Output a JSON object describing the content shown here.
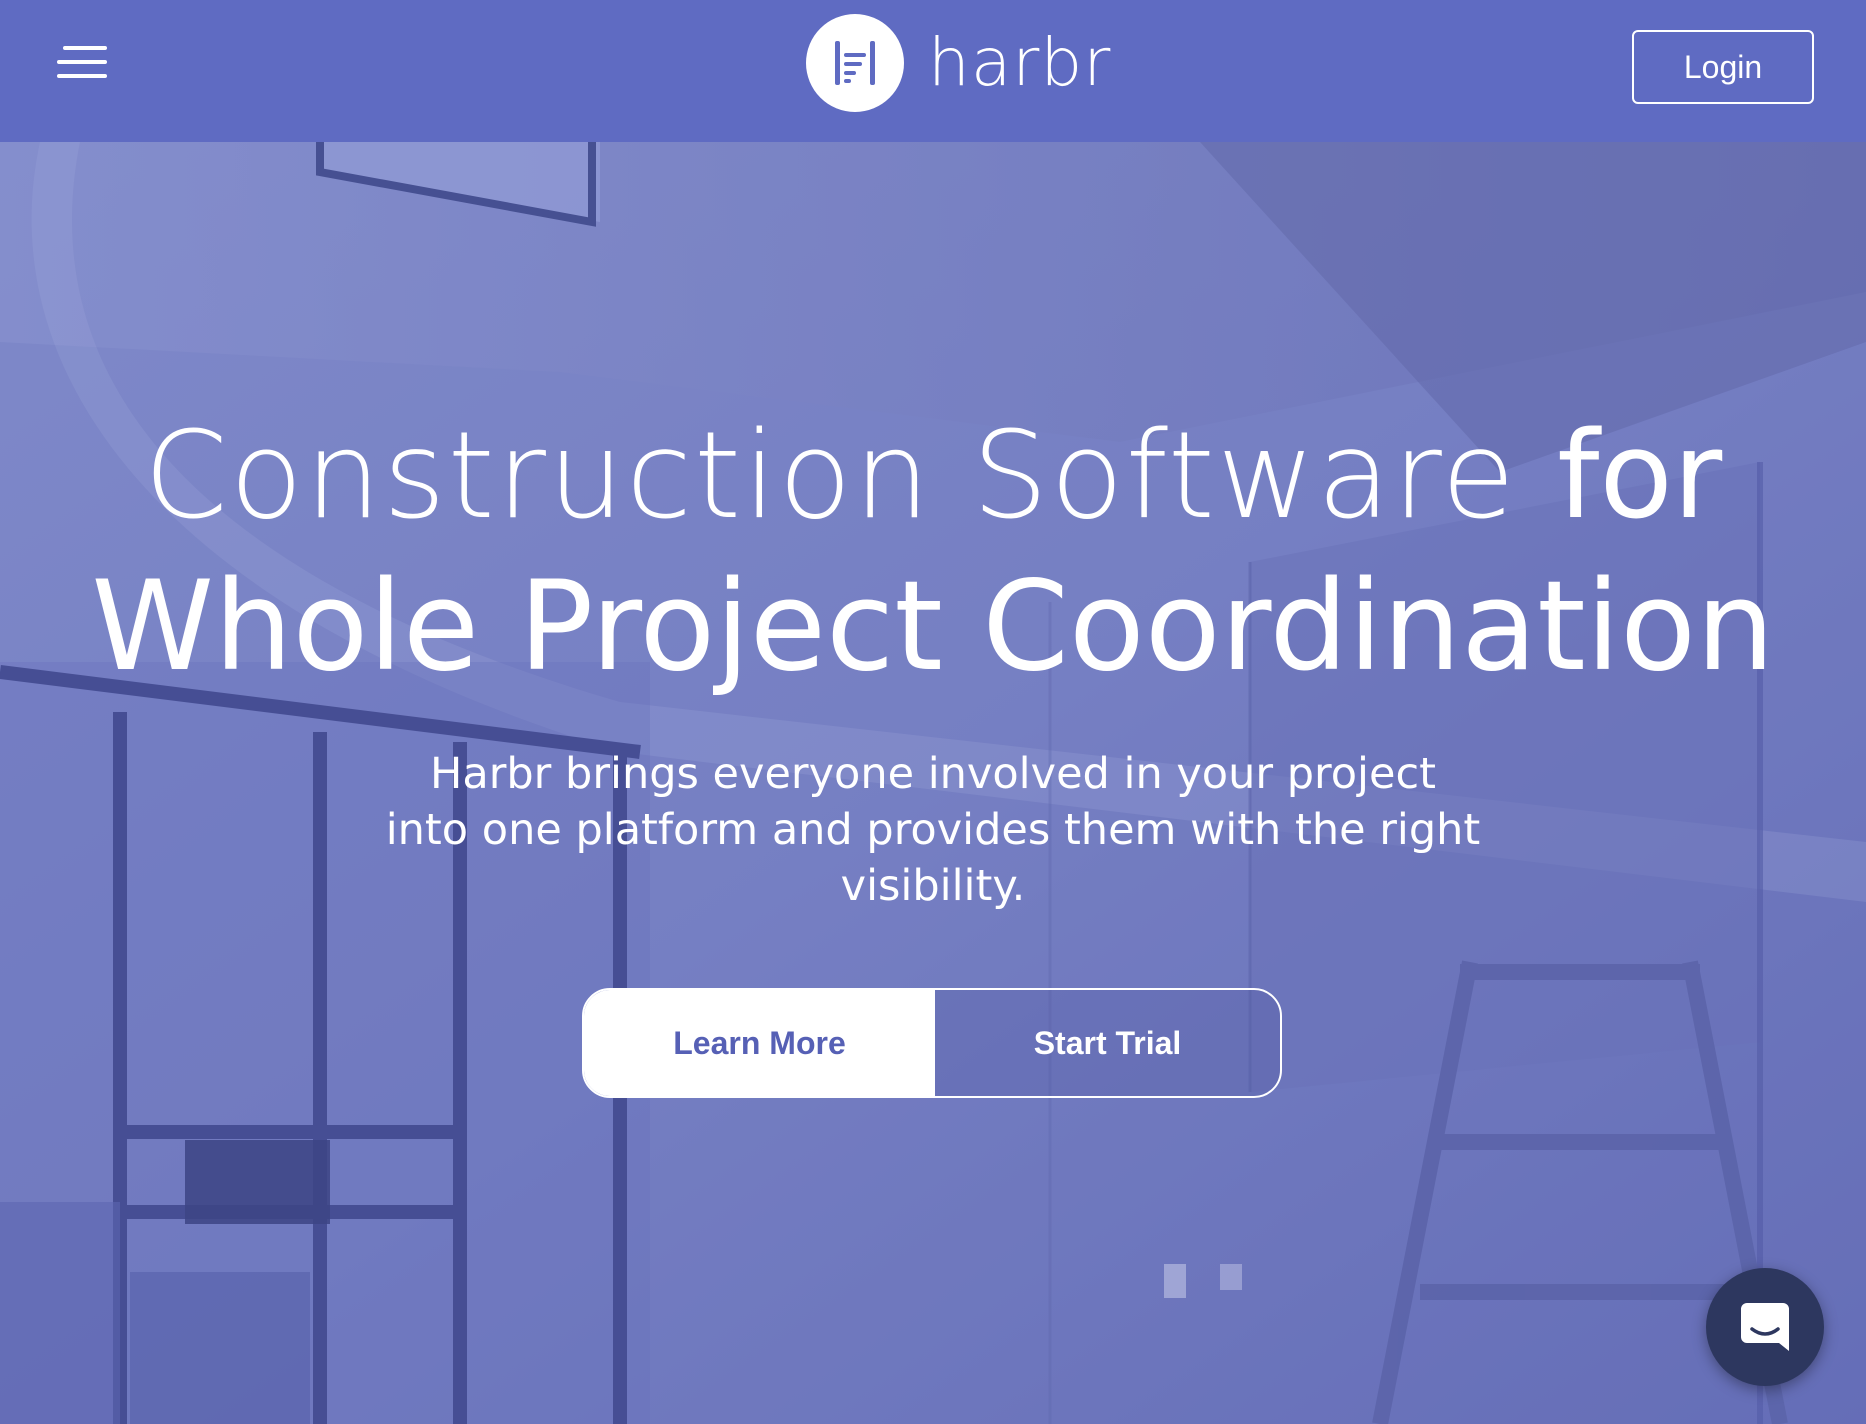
{
  "header": {
    "brand_name": "harbr",
    "login_label": "Login",
    "icons": {
      "menu": "hamburger-menu-icon",
      "logo": "harbr-logo-icon"
    }
  },
  "hero": {
    "title_line1_light": "Construction Software ",
    "title_line1_bold": "for",
    "title_line2": "Whole Project Coordination",
    "subtitle": "Harbr brings everyone involved in your project into one platform and provides them with the right visibility.",
    "learn_more_label": "Learn More",
    "start_trial_label": "Start Trial"
  },
  "chat": {
    "icon": "chat-bubble-icon"
  },
  "colors": {
    "header_bg": "#5f6bc2",
    "hero_overlay": "#6a72bd",
    "button_text": "#5660b5",
    "chat_bg": "#2d375f",
    "text": "#ffffff"
  }
}
